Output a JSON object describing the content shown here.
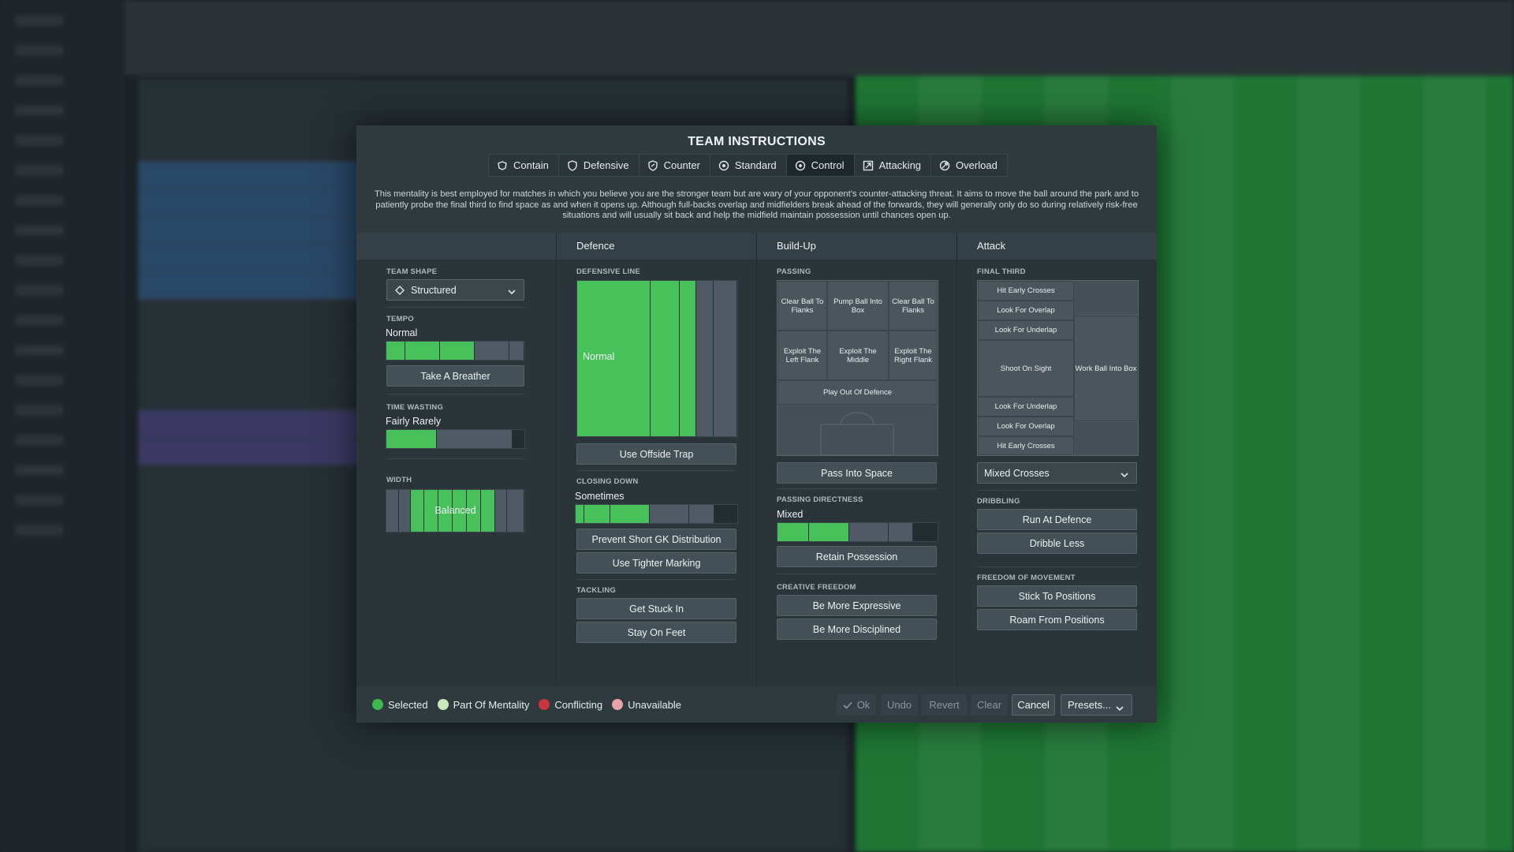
{
  "dialog": {
    "title": "TEAM INSTRUCTIONS",
    "tabs": [
      {
        "label": "Contain",
        "icon": "contain-icon"
      },
      {
        "label": "Defensive",
        "icon": "shield-icon"
      },
      {
        "label": "Counter",
        "icon": "counter-icon"
      },
      {
        "label": "Standard",
        "icon": "standard-icon"
      },
      {
        "label": "Control",
        "icon": "control-icon",
        "active": true
      },
      {
        "label": "Attacking",
        "icon": "attacking-icon"
      },
      {
        "label": "Overload",
        "icon": "overload-icon"
      }
    ],
    "description": "This mentality is best employed for matches in which you believe you are the stronger team but are wary of your opponent's counter-attacking threat. It aims to move the ball around the park and to patiently probe the final third to find space as and when it opens up. Although full-backs overlap and midfielders break ahead of the forwards, they will generally only do so during relatively risk-free situations and will usually sit back and help the midfield maintain possession until chances open up."
  },
  "general": {
    "team_shape_label": "TEAM SHAPE",
    "team_shape_value": "Structured",
    "tempo_label": "TEMPO",
    "tempo_value": "Normal",
    "tempo_level": 0.6,
    "take_a_breather": "Take A Breather",
    "time_wasting_label": "TIME WASTING",
    "time_wasting_value": "Fairly Rarely",
    "time_wasting_level": 0.35,
    "width_label": "WIDTH",
    "width_value": "Balanced"
  },
  "defence": {
    "header": "Defence",
    "defensive_line_label": "DEFENSIVE LINE",
    "defensive_line_value": "Normal",
    "use_offside_trap": "Use Offside Trap",
    "closing_down_label": "CLOSING DOWN",
    "closing_down_value": "Sometimes",
    "closing_down_level": 0.45,
    "prevent_short_gk": "Prevent Short GK Distribution",
    "use_tighter_marking": "Use Tighter Marking",
    "tackling_label": "TACKLING",
    "get_stuck_in": "Get Stuck In",
    "stay_on_feet": "Stay On Feet"
  },
  "buildup": {
    "header": "Build-Up",
    "passing_label": "PASSING",
    "grid": {
      "clear_left": "Clear Ball To Flanks",
      "pump": "Pump Ball Into Box",
      "clear_right": "Clear Ball To Flanks",
      "exploit_left": "Exploit The Left Flank",
      "exploit_middle": "Exploit The Middle",
      "exploit_right": "Exploit The Right Flank",
      "play_out": "Play Out Of Defence"
    },
    "pass_into_space": "Pass Into Space",
    "passing_directness_label": "PASSING DIRECTNESS",
    "passing_directness_value": "Mixed",
    "passing_directness_level": 0.45,
    "retain_possession": "Retain Possession",
    "creative_freedom_label": "CREATIVE FREEDOM",
    "be_more_expressive": "Be More Expressive",
    "be_more_disciplined": "Be More Disciplined"
  },
  "attack": {
    "header": "Attack",
    "final_third_label": "FINAL THIRD",
    "grid": {
      "hit_early_crosses_top": "Hit Early Crosses",
      "look_for_overlap_top": "Look For Overlap",
      "look_for_underlap_top": "Look For Underlap",
      "shoot_on_sight": "Shoot On Sight",
      "work_ball_into_box": "Work Ball Into Box",
      "look_for_underlap_bottom": "Look For Underlap",
      "look_for_overlap_bottom": "Look For Overlap",
      "hit_early_crosses_bottom": "Hit Early Crosses"
    },
    "crossing_value": "Mixed Crosses",
    "dribbling_label": "DRIBBLING",
    "run_at_defence": "Run At Defence",
    "dribble_less": "Dribble Less",
    "freedom_label": "FREEDOM OF MOVEMENT",
    "stick_to_positions": "Stick To Positions",
    "roam_from_positions": "Roam From Positions"
  },
  "footer": {
    "legend": [
      {
        "label": "Selected",
        "color": "#3dbb4f"
      },
      {
        "label": "Part Of Mentality",
        "color": "#c9e7b7"
      },
      {
        "label": "Conflicting",
        "color": "#c9353a"
      },
      {
        "label": "Unavailable",
        "color": "#e7a3a7"
      }
    ],
    "ok": "Ok",
    "undo": "Undo",
    "revert": "Revert",
    "clear": "Clear",
    "cancel": "Cancel",
    "presets": "Presets..."
  },
  "colors": {
    "selected_green": "#47c25b",
    "unselected_bar": "#505a64"
  }
}
